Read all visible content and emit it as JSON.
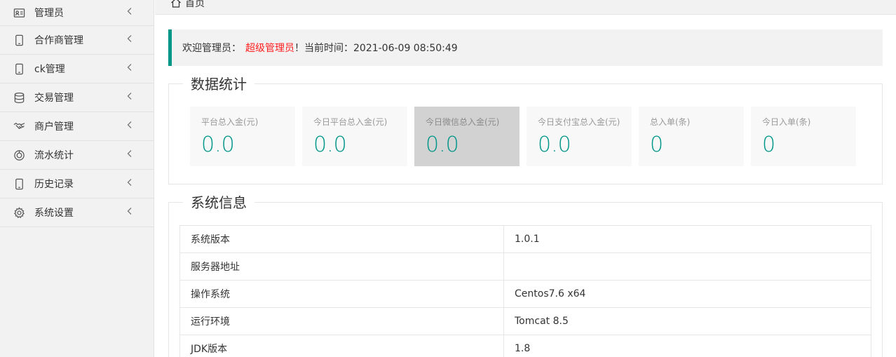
{
  "sidebar": {
    "items": [
      {
        "label": "管理员",
        "icon": "id-card-icon"
      },
      {
        "label": "合作商管理",
        "icon": "phone-icon"
      },
      {
        "label": "ck管理",
        "icon": "phone-icon"
      },
      {
        "label": "交易管理",
        "icon": "database-icon"
      },
      {
        "label": "商户管理",
        "icon": "handshake-icon"
      },
      {
        "label": "流水统计",
        "icon": "chart-circle-icon"
      },
      {
        "label": "历史记录",
        "icon": "phone-icon"
      },
      {
        "label": "系统设置",
        "icon": "gear-icon"
      }
    ]
  },
  "topbar": {
    "home_label": "首页"
  },
  "welcome": {
    "prefix": "欢迎管理员：",
    "role": "超级管理员",
    "suffix": "！当前时间：2021-06-09 08:50:49"
  },
  "stats": {
    "title": "数据统计",
    "cards": [
      {
        "label": "平台总入金(元)",
        "value": "0.0"
      },
      {
        "label": "今日平台总入金(元)",
        "value": "0.0"
      },
      {
        "label": "今日微信总入金(元)",
        "value": "0.0"
      },
      {
        "label": "今日支付宝总入金(元)",
        "value": "0.0"
      },
      {
        "label": "总入单(条)",
        "value": "0"
      },
      {
        "label": "今日入单(条)",
        "value": "0"
      }
    ]
  },
  "system": {
    "title": "系统信息",
    "rows": [
      {
        "key": "系统版本",
        "value": "1.0.1"
      },
      {
        "key": "服务器地址",
        "value": ""
      },
      {
        "key": "操作系统",
        "value": "Centos7.6 x64"
      },
      {
        "key": "运行环境",
        "value": "Tomcat 8.5"
      },
      {
        "key": "JDK版本",
        "value": "1.8"
      }
    ]
  },
  "colors": {
    "accent": "#009688",
    "highlight": "#ff1e1e",
    "sidebar_bg": "#f2f2f2"
  }
}
